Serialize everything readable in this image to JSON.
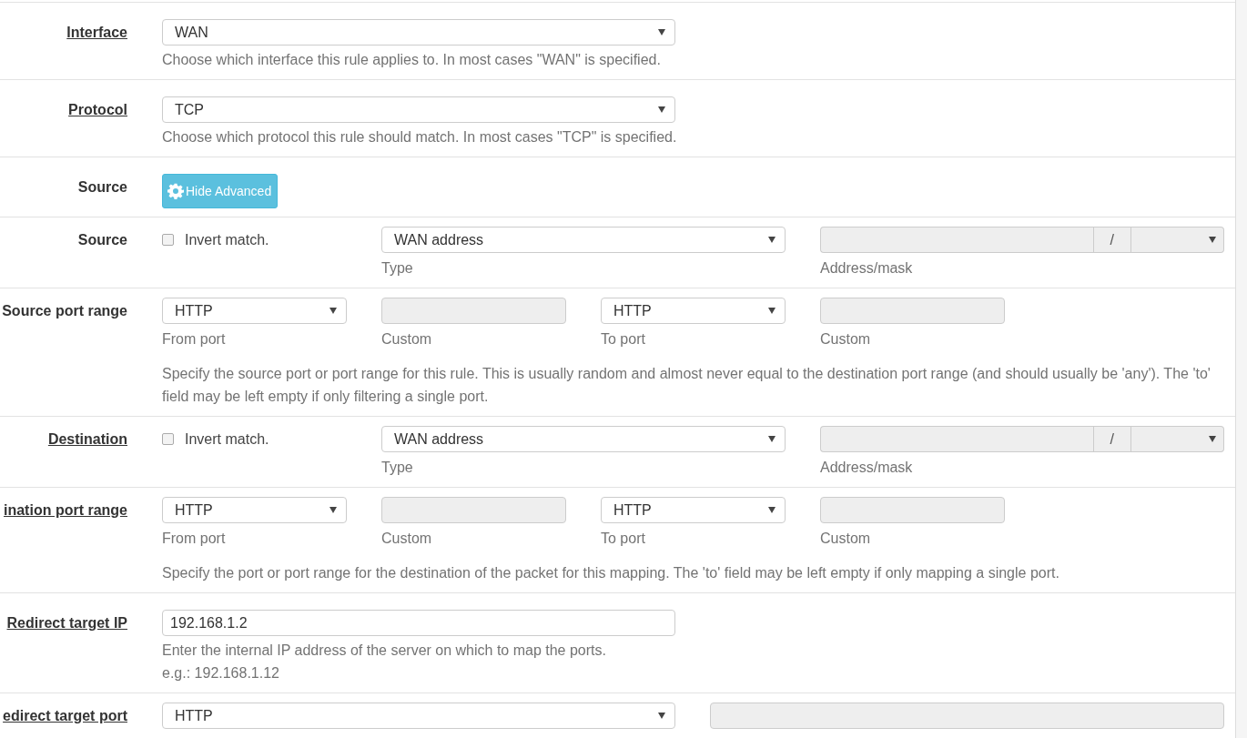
{
  "rows": [
    {
      "kind": "select",
      "label": "Interface",
      "link": true,
      "value": "WAN",
      "help": "Choose which interface this rule applies to. In most cases \"WAN\" is specified."
    },
    {
      "kind": "select",
      "label": "Protocol",
      "link": true,
      "value": "TCP",
      "help": "Choose which protocol this rule should match. In most cases \"TCP\" is specified."
    },
    {
      "kind": "button",
      "label": "Source",
      "link": false,
      "button": "Hide Advanced"
    },
    {
      "kind": "address",
      "label": "Source",
      "link": false,
      "invert": {
        "label": "Invert match.",
        "checked": false
      },
      "type": {
        "value": "WAN address",
        "caption": "Type"
      },
      "address": {
        "disabled": true,
        "separator": "/",
        "caption": "Address/mask"
      }
    },
    {
      "kind": "port_range",
      "label": "Source port range",
      "link": false,
      "ports": [
        {
          "kind": "select",
          "value": "HTTP",
          "caption": "From port"
        },
        {
          "kind": "input",
          "disabled": true,
          "caption": "Custom"
        },
        {
          "kind": "select",
          "value": "HTTP",
          "caption": "To port"
        },
        {
          "kind": "input",
          "disabled": true,
          "caption": "Custom"
        }
      ],
      "help": "Specify the source port or port range for this rule. This is usually random and almost never equal to the destination port range (and should usually be 'any'). The 'to' field may be left empty if only filtering a single port."
    },
    {
      "kind": "address",
      "label": "Destination",
      "link": true,
      "invert": {
        "label": "Invert match.",
        "checked": false
      },
      "type": {
        "value": "WAN address",
        "caption": "Type"
      },
      "address": {
        "disabled": true,
        "separator": "/",
        "caption": "Address/mask"
      }
    },
    {
      "kind": "port_range",
      "label": "ination port range",
      "link": true,
      "ports": [
        {
          "kind": "select",
          "value": "HTTP",
          "caption": "From port"
        },
        {
          "kind": "input",
          "disabled": true,
          "caption": "Custom"
        },
        {
          "kind": "select",
          "value": "HTTP",
          "caption": "To port"
        },
        {
          "kind": "input",
          "disabled": true,
          "caption": "Custom"
        }
      ],
      "help": "Specify the port or port range for the destination of the packet for this mapping. The 'to' field may be left empty if only mapping a single port."
    },
    {
      "kind": "input",
      "label": "Redirect target IP",
      "link": true,
      "value": "192.168.1.2",
      "help": "Enter the internal IP address of the server on which to map the ports.",
      "example": "e.g.: 192.168.1.12"
    },
    {
      "kind": "select_input",
      "label": "edirect target port",
      "link": true,
      "value": "HTTP",
      "custom": {
        "disabled": true
      }
    }
  ]
}
